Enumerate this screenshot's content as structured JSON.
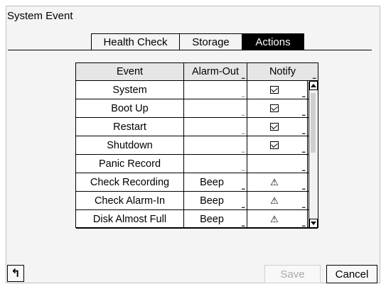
{
  "window": {
    "title": "System Event"
  },
  "tabs": [
    {
      "label": "Health Check",
      "active": false
    },
    {
      "label": "Storage",
      "active": false
    },
    {
      "label": "Actions",
      "active": true
    }
  ],
  "table": {
    "headers": [
      "Event",
      "Alarm-Out",
      "Notify"
    ],
    "more_glyph": "...",
    "rows": [
      {
        "event": "System",
        "alarm_out": "",
        "notify": "checked"
      },
      {
        "event": "Boot Up",
        "alarm_out": "",
        "notify": "checked"
      },
      {
        "event": "Restart",
        "alarm_out": "",
        "notify": "checked"
      },
      {
        "event": "Shutdown",
        "alarm_out": "",
        "notify": "checked"
      },
      {
        "event": "Panic Record",
        "alarm_out": "",
        "notify": ""
      },
      {
        "event": "Check Recording",
        "alarm_out": "Beep",
        "notify": "warning"
      },
      {
        "event": "Check Alarm-In",
        "alarm_out": "Beep",
        "notify": "warning"
      },
      {
        "event": "Disk Almost Full",
        "alarm_out": "Beep",
        "notify": "warning"
      }
    ]
  },
  "icons": {
    "back": "back-arrow-icon",
    "checkbox": "checkbox-checked-icon",
    "warning": "warning-icon",
    "scroll_up": "scroll-up-arrow-icon",
    "scroll_down": "scroll-down-arrow-icon"
  },
  "glyphs": {
    "warning": "⚠"
  },
  "footer": {
    "save_label": "Save",
    "cancel_label": "Cancel",
    "back_symbol": "↰"
  }
}
